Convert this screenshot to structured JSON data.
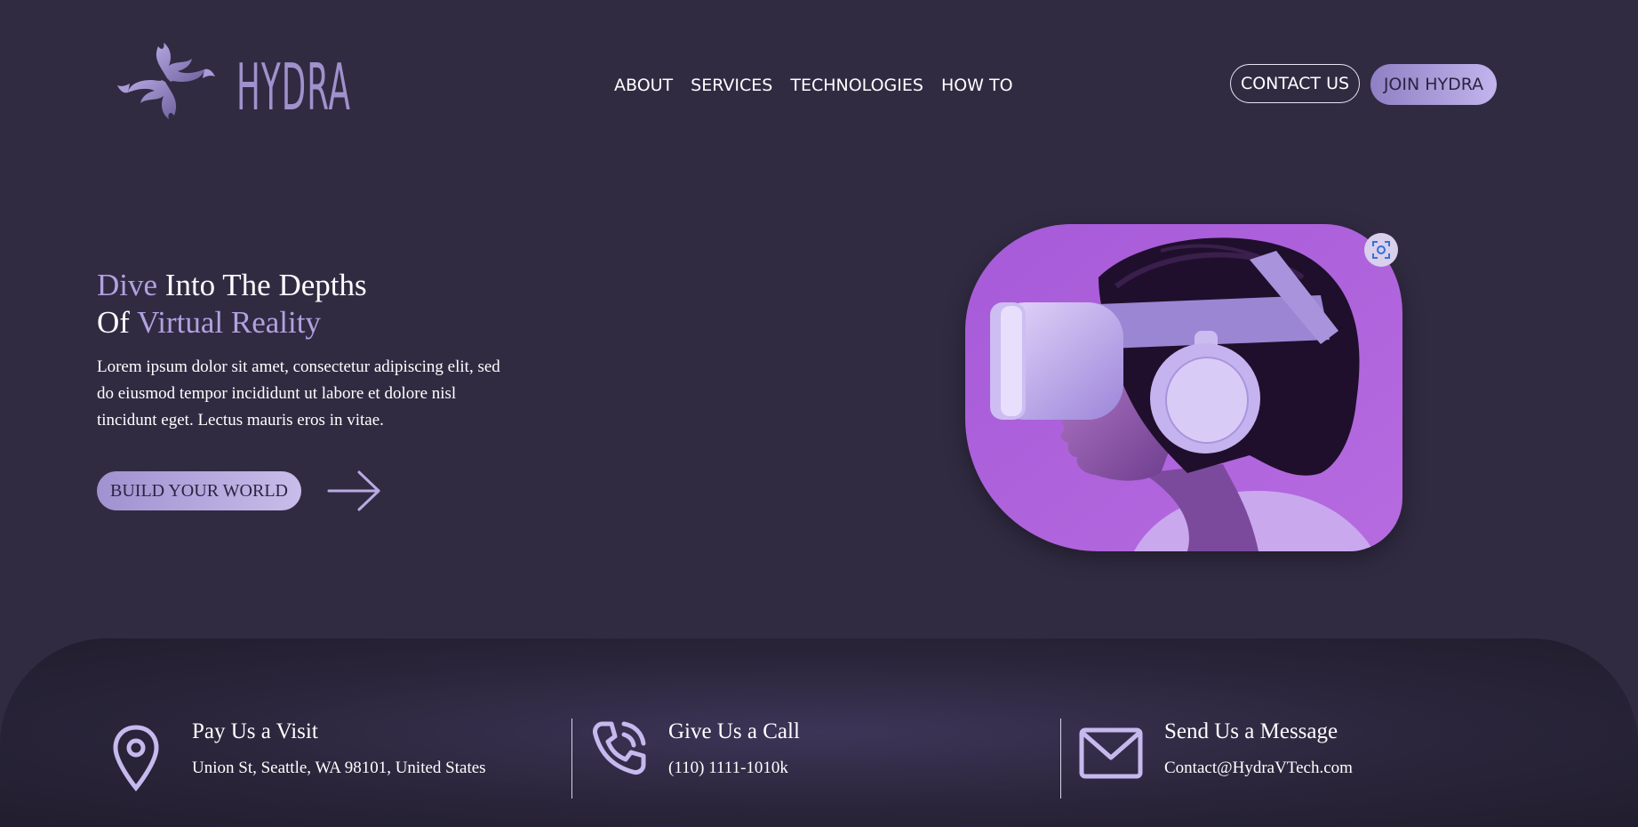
{
  "brand": {
    "name": "HYDRA",
    "accent_color": "#9f92cc"
  },
  "nav": {
    "items": [
      {
        "label": "ABOUT"
      },
      {
        "label": "SERVICES"
      },
      {
        "label": "TECHNOLOGIES"
      },
      {
        "label": "HOW TO"
      }
    ]
  },
  "header": {
    "contact_label": "CONTACT US",
    "join_label": "JOIN HYDRA"
  },
  "hero": {
    "title_line1_accent": "Dive",
    "title_line1_rest": " Into The Depths",
    "title_line2_start": "Of ",
    "title_line2_accent": "Virtual Reality",
    "description": "Lorem ipsum dolor sit amet, consectetur adipiscing elit, sed do eiusmod tempor incididunt ut labore et dolore nisl tincidunt eget. Lectus mauris eros in vitae.",
    "cta_label": "BUILD YOUR WORLD",
    "arrow_icon": "arrow-right-icon",
    "image_icon": "scan-icon"
  },
  "contact": {
    "items": [
      {
        "icon": "location-pin-icon",
        "title": "Pay Us a Visit",
        "value": "Union St, Seattle, WA 98101, United States"
      },
      {
        "icon": "phone-icon",
        "title": "Give Us a Call",
        "value": "(110) 1111-1010k"
      },
      {
        "icon": "mail-icon",
        "title": "Send Us a Message",
        "value": "Contact@HydraVTech.com"
      }
    ]
  },
  "colors": {
    "background": "#312b42",
    "accent": "#b0a2e0",
    "button_gradient_start": "#8f80c4",
    "button_gradient_end": "#c2b4ec"
  }
}
